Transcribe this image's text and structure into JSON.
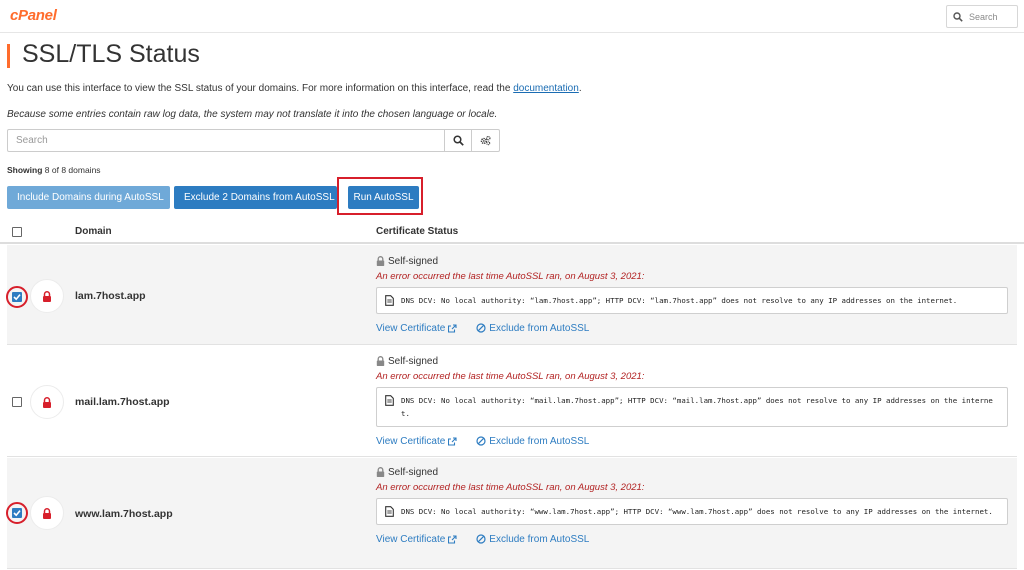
{
  "app": {
    "logo": "cPanel",
    "search_placeholder": "Search"
  },
  "page": {
    "title": "SSL/TLS Status",
    "intro_text": "You can use this interface to view the SSL status of your domains. For more information on this interface, read the ",
    "intro_link": "documentation",
    "intro_end": ".",
    "note": "Because some entries contain raw log data, the system may not translate it into the chosen language or locale."
  },
  "filter": {
    "search_placeholder": "Search"
  },
  "showing": {
    "label": "Showing",
    "text": " 8 of 8 domains"
  },
  "actions": {
    "include": "Include Domains during AutoSSL",
    "exclude": "Exclude 2 Domains from AutoSSL",
    "run": "Run AutoSSL"
  },
  "table": {
    "col_domain": "Domain",
    "col_status": "Certificate Status",
    "rows": [
      {
        "domain": "lam.7host.app",
        "checked": true,
        "status": "Self-signed",
        "error": "An error occurred the last time AutoSSL ran, on August 3, 2021:",
        "log": "DNS DCV: No local authority: “lam.7host.app”; HTTP DCV: “lam.7host.app” does not resolve to any IP addresses on the internet.",
        "view": "View Certificate",
        "exclude": "Exclude from AutoSSL"
      },
      {
        "domain": "mail.lam.7host.app",
        "checked": false,
        "status": "Self-signed",
        "error": "An error occurred the last time AutoSSL ran, on August 3, 2021:",
        "log": "DNS DCV: No local authority: “mail.lam.7host.app”; HTTP DCV: “mail.lam.7host.app” does not resolve to any IP addresses on the internet.",
        "view": "View Certificate",
        "exclude": "Exclude from AutoSSL"
      },
      {
        "domain": "www.lam.7host.app",
        "checked": true,
        "status": "Self-signed",
        "error": "An error occurred the last time AutoSSL ran, on August 3, 2021:",
        "log": "DNS DCV: No local authority: “www.lam.7host.app”; HTTP DCV: “www.lam.7host.app” does not resolve to any IP addresses on the internet.",
        "view": "View Certificate",
        "exclude": "Exclude from AutoSSL"
      }
    ]
  },
  "colors": {
    "brand": "#ff6c2c",
    "primary": "#2d7cc1",
    "error": "#b22222",
    "highlight": "#d71f2b"
  }
}
